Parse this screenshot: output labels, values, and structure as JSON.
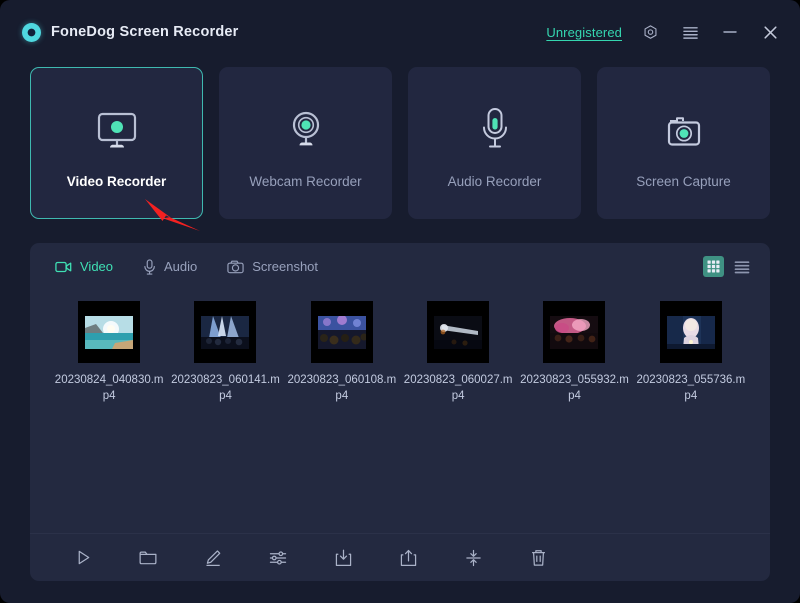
{
  "window": {
    "title": "FoneDog Screen Recorder",
    "logo_icon": "fonedog-logo-icon",
    "account_link": "Unregistered",
    "settings_icon": "gear-hex-icon",
    "menu_icon": "hamburger-menu-icon",
    "minimize_icon": "minimize-icon",
    "close_icon": "close-icon",
    "accent_color": "#3fe0b4",
    "background_color": "#171c2e",
    "panel_color": "#232940",
    "card_color": "#222740"
  },
  "modes": [
    {
      "label": "Video Recorder",
      "icon": "monitor-record-icon",
      "active": true
    },
    {
      "label": "Webcam Recorder",
      "icon": "webcam-icon",
      "active": false
    },
    {
      "label": "Audio Recorder",
      "icon": "microphone-icon",
      "active": false
    },
    {
      "label": "Screen Capture",
      "icon": "camera-icon",
      "active": false
    }
  ],
  "annotation": {
    "arrow_color": "#f42121",
    "points_to": "Video Recorder"
  },
  "library": {
    "tabs": [
      {
        "label": "Video",
        "icon": "video-camera-icon",
        "active": true
      },
      {
        "label": "Audio",
        "icon": "microphone-icon",
        "active": false
      },
      {
        "label": "Screenshot",
        "icon": "camera-icon",
        "active": false
      }
    ],
    "view_modes": [
      {
        "name": "grid-view",
        "icon": "grid-icon",
        "active": true
      },
      {
        "name": "list-view",
        "icon": "list-icon",
        "active": false
      }
    ],
    "files": [
      {
        "name": "20230824_040830.mp4",
        "thumb": "beach-sunset"
      },
      {
        "name": "20230823_060141.mp4",
        "thumb": "concert-stage"
      },
      {
        "name": "20230823_060108.mp4",
        "thumb": "concert-crowd"
      },
      {
        "name": "20230823_060027.mp4",
        "thumb": "dark-stage"
      },
      {
        "name": "20230823_055932.mp4",
        "thumb": "pink-lights"
      },
      {
        "name": "20230823_055736.mp4",
        "thumb": "singer-blue"
      }
    ],
    "toolbar": [
      {
        "name": "play-button",
        "icon": "play-icon"
      },
      {
        "name": "folder-button",
        "icon": "folder-icon"
      },
      {
        "name": "edit-button",
        "icon": "pencil-icon"
      },
      {
        "name": "settings-button",
        "icon": "sliders-icon"
      },
      {
        "name": "download-button",
        "icon": "download-icon"
      },
      {
        "name": "share-button",
        "icon": "share-upload-icon"
      },
      {
        "name": "compress-button",
        "icon": "compress-icon"
      },
      {
        "name": "delete-button",
        "icon": "trash-icon"
      }
    ]
  }
}
